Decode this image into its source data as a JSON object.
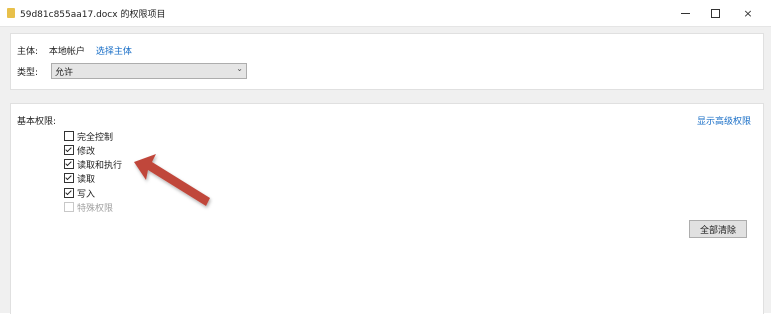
{
  "window": {
    "title": "59d81c855aa17.docx 的权限项目",
    "controls": {
      "minimize": "minimize",
      "maximize": "maximize",
      "close": "×"
    }
  },
  "principal": {
    "label": "主体:",
    "value": "本地帐户",
    "select_link": "选择主体"
  },
  "type": {
    "label": "类型:",
    "selected": "允许"
  },
  "permissions": {
    "heading": "基本权限:",
    "advanced_link": "显示高级权限",
    "items": [
      {
        "label": "完全控制",
        "checked": false,
        "disabled": false
      },
      {
        "label": "修改",
        "checked": true,
        "disabled": false
      },
      {
        "label": "读取和执行",
        "checked": true,
        "disabled": false
      },
      {
        "label": "读取",
        "checked": true,
        "disabled": false
      },
      {
        "label": "写入",
        "checked": true,
        "disabled": false
      },
      {
        "label": "特殊权限",
        "checked": false,
        "disabled": true
      }
    ],
    "clear_all": "全部清除"
  },
  "annotation": {
    "color": "#c0463b",
    "icon": "arrow-pointer"
  }
}
